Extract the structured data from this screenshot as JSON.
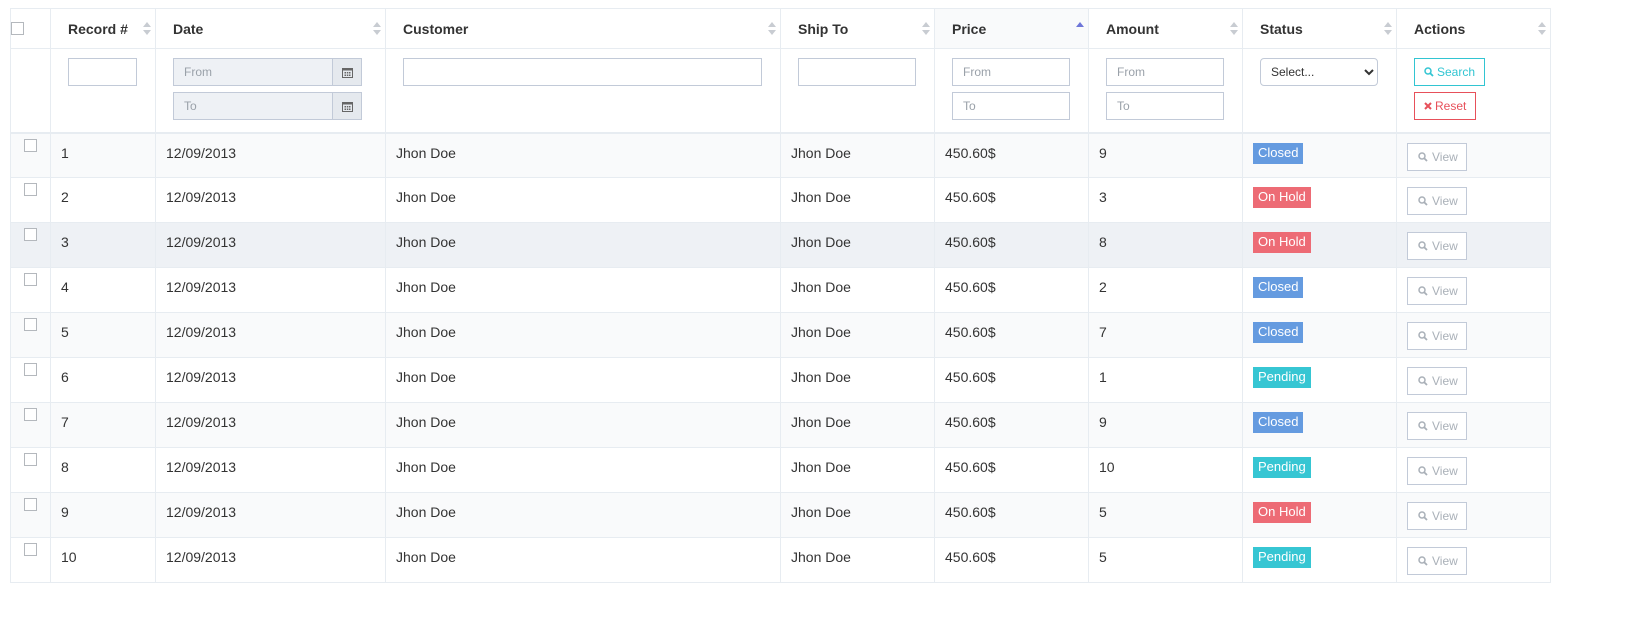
{
  "columns": [
    {
      "label": "Record #"
    },
    {
      "label": "Date"
    },
    {
      "label": "Customer"
    },
    {
      "label": "Ship To"
    },
    {
      "label": "Price"
    },
    {
      "label": "Amount"
    },
    {
      "label": "Status"
    },
    {
      "label": "Actions"
    }
  ],
  "filters": {
    "date_from_placeholder": "From",
    "date_to_placeholder": "To",
    "price_from_placeholder": "From",
    "price_to_placeholder": "To",
    "amount_from_placeholder": "From",
    "amount_to_placeholder": "To",
    "status_selected": "Select...",
    "search_label": "Search",
    "reset_label": "Reset"
  },
  "rows": [
    {
      "record": "1",
      "date": "12/09/2013",
      "customer": "Jhon Doe",
      "ship_to": "Jhon Doe",
      "price": "450.60$",
      "amount": "9",
      "status": "Closed",
      "action": "View"
    },
    {
      "record": "2",
      "date": "12/09/2013",
      "customer": "Jhon Doe",
      "ship_to": "Jhon Doe",
      "price": "450.60$",
      "amount": "3",
      "status": "On Hold",
      "action": "View"
    },
    {
      "record": "3",
      "date": "12/09/2013",
      "customer": "Jhon Doe",
      "ship_to": "Jhon Doe",
      "price": "450.60$",
      "amount": "8",
      "status": "On Hold",
      "action": "View"
    },
    {
      "record": "4",
      "date": "12/09/2013",
      "customer": "Jhon Doe",
      "ship_to": "Jhon Doe",
      "price": "450.60$",
      "amount": "2",
      "status": "Closed",
      "action": "View"
    },
    {
      "record": "5",
      "date": "12/09/2013",
      "customer": "Jhon Doe",
      "ship_to": "Jhon Doe",
      "price": "450.60$",
      "amount": "7",
      "status": "Closed",
      "action": "View"
    },
    {
      "record": "6",
      "date": "12/09/2013",
      "customer": "Jhon Doe",
      "ship_to": "Jhon Doe",
      "price": "450.60$",
      "amount": "1",
      "status": "Pending",
      "action": "View"
    },
    {
      "record": "7",
      "date": "12/09/2013",
      "customer": "Jhon Doe",
      "ship_to": "Jhon Doe",
      "price": "450.60$",
      "amount": "9",
      "status": "Closed",
      "action": "View"
    },
    {
      "record": "8",
      "date": "12/09/2013",
      "customer": "Jhon Doe",
      "ship_to": "Jhon Doe",
      "price": "450.60$",
      "amount": "10",
      "status": "Pending",
      "action": "View"
    },
    {
      "record": "9",
      "date": "12/09/2013",
      "customer": "Jhon Doe",
      "ship_to": "Jhon Doe",
      "price": "450.60$",
      "amount": "5",
      "status": "On Hold",
      "action": "View"
    },
    {
      "record": "10",
      "date": "12/09/2013",
      "customer": "Jhon Doe",
      "ship_to": "Jhon Doe",
      "price": "450.60$",
      "amount": "5",
      "status": "Pending",
      "action": "View"
    }
  ],
  "status_colors": {
    "Closed": "#659be0",
    "On Hold": "#ed6b75",
    "Pending": "#36c6d3"
  },
  "icons": {
    "header_sort": "sort-arrows-icon",
    "date_picker": "calendar-icon",
    "search": "search-icon",
    "reset": "close-icon",
    "view": "search-icon"
  },
  "sorted_column": "Price"
}
